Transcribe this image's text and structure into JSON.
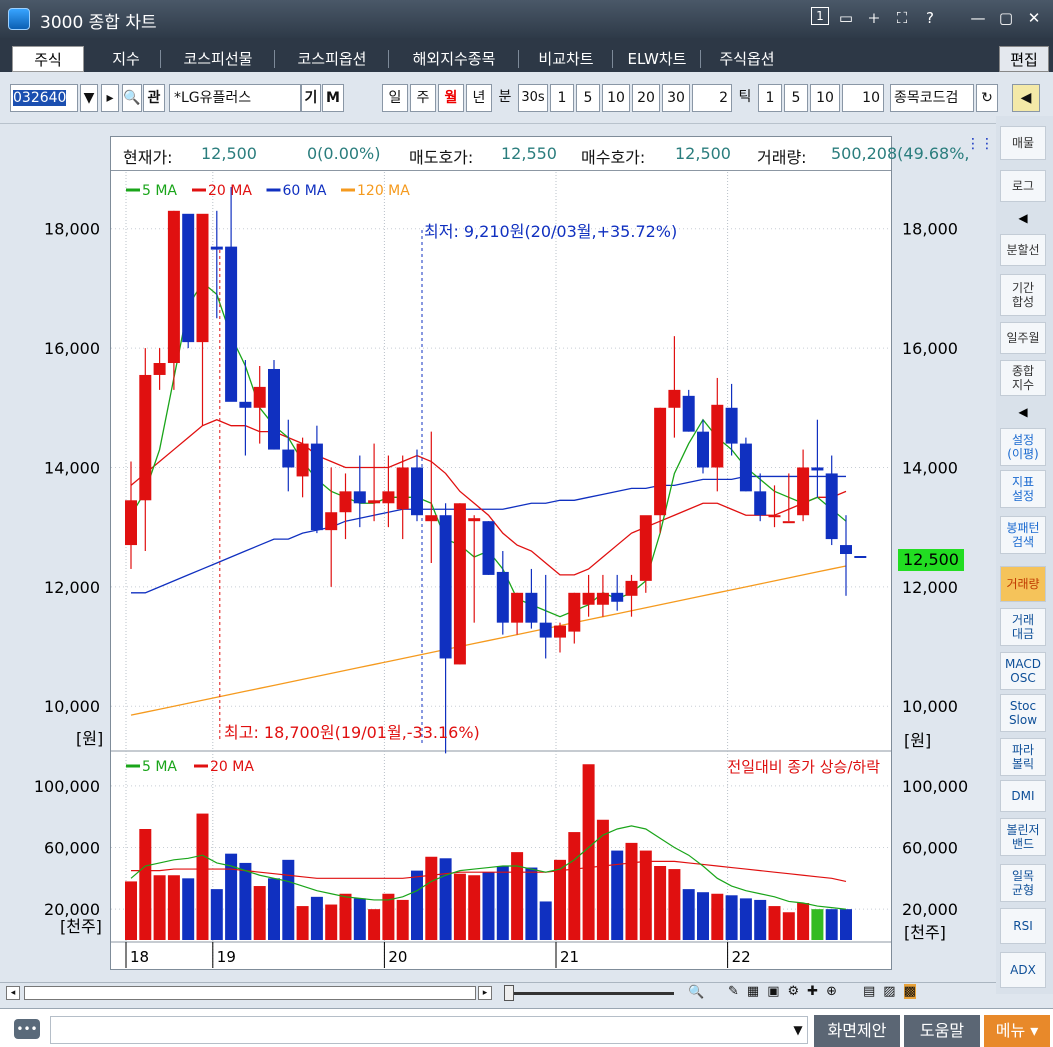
{
  "window": {
    "title": "3000 종합 차트"
  },
  "title_icons": [
    "1",
    "▭",
    "🞣",
    "⛶",
    "?",
    "—",
    "▢",
    "✕"
  ],
  "tabs": [
    "주식",
    "지수",
    "코스피선물",
    "코스피옵션",
    "해외지수종목",
    "비교차트",
    "ELW차트",
    "주식옵션"
  ],
  "edit_label": "편집",
  "toolbar": {
    "code": "032640",
    "name": "*LG유플러스",
    "gi": "기",
    "m": "M",
    "periods": [
      "일",
      "주",
      "월",
      "년",
      "분",
      "30s",
      "1",
      "5",
      "10",
      "20",
      "30"
    ],
    "active_period": "월",
    "tick_count": "2",
    "tick_label": "틱",
    "tick_opts": [
      "1",
      "5",
      "10"
    ],
    "tick_count2": "10",
    "search_placeholder": "종목코드검"
  },
  "info": {
    "current_label": "현재가:",
    "current": "12,500",
    "change": "0(0.00%)",
    "ask_label": "매도호가:",
    "ask": "12,550",
    "bid_label": "매수호가:",
    "bid": "12,500",
    "vol_label": "거래량:",
    "vol": "500,208(49.68%,"
  },
  "legend_price": [
    {
      "label": "5 MA",
      "color": "#1aa51a"
    },
    {
      "label": "20 MA",
      "color": "#e01010"
    },
    {
      "label": "60 MA",
      "color": "#1030c0"
    },
    {
      "label": "120 MA",
      "color": "#f59a1e"
    }
  ],
  "legend_volume": [
    {
      "label": "5 MA",
      "color": "#1aa51a"
    },
    {
      "label": "20 MA",
      "color": "#e01010"
    }
  ],
  "volume_caption": "전일대비 종가 상승/하락",
  "annotations": {
    "low": "최저: 9,210원(20/03월,+35.72%)",
    "high": "최고: 18,700원(19/01월,-33.16%)"
  },
  "price_axis": [
    "18,000",
    "16,000",
    "14,000",
    "12,000",
    "10,000"
  ],
  "price_unit": "[원]",
  "volume_axis": [
    "100,000",
    "60,000",
    "20,000"
  ],
  "volume_unit": "[천주]",
  "current_price_tag": "12,500",
  "x_years": [
    "18",
    "19",
    "20",
    "21",
    "22"
  ],
  "sidebar": [
    "매물",
    "로그",
    "◀",
    "분할선",
    "기간\n합성",
    "일주월",
    "종합\n지수",
    "◀",
    "설정\n(이평)",
    "지표\n설정",
    "봉패턴\n검색",
    "거래량",
    "거래\n대금",
    "MACD\nOSC",
    "Stoc\nSlow",
    "파라\n볼릭",
    "DMI",
    "볼린저\n밴드",
    "일목\n균형",
    "RSI",
    "ADX"
  ],
  "status": {
    "btn1": "화면제안",
    "btn2": "도움말",
    "btn3": "메뉴 ▾"
  },
  "chart_data": {
    "type": "candlestick",
    "ylim": [
      9300,
      18900
    ],
    "vol_ylim": [
      0,
      120000
    ],
    "candles": [
      {
        "o": 12700,
        "h": 14100,
        "l": 12300,
        "c": 13450,
        "v": 38000
      },
      {
        "o": 13450,
        "h": 16000,
        "l": 12600,
        "c": 15550,
        "v": 72000
      },
      {
        "o": 15550,
        "h": 16000,
        "l": 15300,
        "c": 15750,
        "v": 42000
      },
      {
        "o": 15750,
        "h": 18300,
        "l": 15300,
        "c": 18300,
        "v": 42000
      },
      {
        "o": 18250,
        "h": 18200,
        "l": 16000,
        "c": 16100,
        "v": 40000
      },
      {
        "o": 16100,
        "h": 18200,
        "l": 14700,
        "c": 18250,
        "v": 82000
      },
      {
        "o": 17700,
        "h": 18300,
        "l": 16500,
        "c": 17650,
        "v": 33000
      },
      {
        "o": 17700,
        "h": 18700,
        "l": 15800,
        "c": 15100,
        "v": 56000
      },
      {
        "o": 15100,
        "h": 15800,
        "l": 14200,
        "c": 15000,
        "v": 50000
      },
      {
        "o": 15000,
        "h": 15700,
        "l": 14400,
        "c": 15350,
        "v": 35000
      },
      {
        "o": 15650,
        "h": 15800,
        "l": 14300,
        "c": 14300,
        "v": 40000
      },
      {
        "o": 14300,
        "h": 14800,
        "l": 13600,
        "c": 14000,
        "v": 52000
      },
      {
        "o": 13850,
        "h": 14500,
        "l": 13500,
        "c": 14400,
        "v": 22000
      },
      {
        "o": 14400,
        "h": 14700,
        "l": 12900,
        "c": 12950,
        "v": 28000
      },
      {
        "o": 12950,
        "h": 14000,
        "l": 12000,
        "c": 13250,
        "v": 23000
      },
      {
        "o": 13250,
        "h": 13900,
        "l": 12800,
        "c": 13600,
        "v": 30000
      },
      {
        "o": 13600,
        "h": 14200,
        "l": 13000,
        "c": 13400,
        "v": 27000
      },
      {
        "o": 13400,
        "h": 14400,
        "l": 13100,
        "c": 13450,
        "v": 20000
      },
      {
        "o": 13400,
        "h": 14200,
        "l": 13000,
        "c": 13600,
        "v": 30000
      },
      {
        "o": 13300,
        "h": 14200,
        "l": 12800,
        "c": 14000,
        "v": 26000
      },
      {
        "o": 14000,
        "h": 14300,
        "l": 13100,
        "c": 13200,
        "v": 45000
      },
      {
        "o": 13100,
        "h": 14600,
        "l": 12400,
        "c": 13200,
        "v": 54000
      },
      {
        "o": 13200,
        "h": 13400,
        "l": 9210,
        "c": 10800,
        "v": 53000
      },
      {
        "o": 10700,
        "h": 13400,
        "l": 10700,
        "c": 13400,
        "v": 43000
      },
      {
        "o": 13100,
        "h": 13200,
        "l": 11400,
        "c": 13150,
        "v": 42000
      },
      {
        "o": 13100,
        "h": 13100,
        "l": 12200,
        "c": 12200,
        "v": 44000
      },
      {
        "o": 12250,
        "h": 12600,
        "l": 11200,
        "c": 11400,
        "v": 48000
      },
      {
        "o": 11400,
        "h": 11900,
        "l": 11200,
        "c": 11900,
        "v": 57000
      },
      {
        "o": 11900,
        "h": 12300,
        "l": 11300,
        "c": 11400,
        "v": 47000
      },
      {
        "o": 11400,
        "h": 12200,
        "l": 10800,
        "c": 11150,
        "v": 25000
      },
      {
        "o": 11150,
        "h": 11400,
        "l": 10900,
        "c": 11350,
        "v": 52000
      },
      {
        "o": 11250,
        "h": 11900,
        "l": 11050,
        "c": 11900,
        "v": 70000
      },
      {
        "o": 11700,
        "h": 12200,
        "l": 11500,
        "c": 11900,
        "v": 114000
      },
      {
        "o": 11700,
        "h": 12200,
        "l": 11500,
        "c": 11900,
        "v": 78000
      },
      {
        "o": 11900,
        "h": 12200,
        "l": 11600,
        "c": 11750,
        "v": 58000
      },
      {
        "o": 11850,
        "h": 12200,
        "l": 11500,
        "c": 12100,
        "v": 63000
      },
      {
        "o": 12100,
        "h": 12900,
        "l": 11900,
        "c": 13200,
        "v": 58000
      },
      {
        "o": 13200,
        "h": 15000,
        "l": 12900,
        "c": 15000,
        "v": 48000
      },
      {
        "o": 15000,
        "h": 16200,
        "l": 14500,
        "c": 15300,
        "v": 46000
      },
      {
        "o": 15200,
        "h": 15300,
        "l": 14600,
        "c": 14600,
        "v": 33000
      },
      {
        "o": 14600,
        "h": 14800,
        "l": 13900,
        "c": 14000,
        "v": 31000
      },
      {
        "o": 14000,
        "h": 15500,
        "l": 13600,
        "c": 15050,
        "v": 30000
      },
      {
        "o": 15000,
        "h": 15400,
        "l": 14200,
        "c": 14400,
        "v": 29000
      },
      {
        "o": 14400,
        "h": 14500,
        "l": 13600,
        "c": 13600,
        "v": 27000
      },
      {
        "o": 13600,
        "h": 13900,
        "l": 13100,
        "c": 13200,
        "v": 26000
      },
      {
        "o": 13200,
        "h": 13700,
        "l": 13000,
        "c": 13200,
        "v": 22000
      },
      {
        "o": 13100,
        "h": 13900,
        "l": 13100,
        "c": 13100,
        "v": 18000
      },
      {
        "o": 13200,
        "h": 14300,
        "l": 13100,
        "c": 14000,
        "v": 24000
      },
      {
        "o": 14000,
        "h": 14800,
        "l": 13500,
        "c": 13950,
        "v": 20000
      },
      {
        "o": 13900,
        "h": 14200,
        "l": 12700,
        "c": 12800,
        "v": 20000
      },
      {
        "o": 12700,
        "h": 13200,
        "l": 11850,
        "c": 12550,
        "v": 20000
      },
      {
        "o": 12500,
        "h": 12500,
        "l": 12500,
        "c": 12500,
        "v": 0
      }
    ],
    "ma5": [
      13200,
      13600,
      14300,
      15500,
      16700,
      17100,
      16900,
      16200,
      15700,
      15000,
      14700,
      14500,
      14100,
      13800,
      13600,
      13500,
      13400,
      13400,
      13500,
      13500,
      13500,
      13400,
      12800,
      12700,
      12500,
      12600,
      12300,
      11800,
      11700,
      11600,
      11500,
      11600,
      11700,
      11900,
      11800,
      11900,
      12100,
      12900,
      13900,
      14400,
      14800,
      14500,
      14300,
      14000,
      13800,
      13600,
      13500,
      13400,
      13500,
      13300,
      13100
    ],
    "ma20": [
      13700,
      13900,
      14100,
      14300,
      14500,
      14700,
      14800,
      14700,
      14700,
      14600,
      14600,
      14500,
      14400,
      14200,
      14100,
      14000,
      14000,
      14000,
      14000,
      14100,
      14200,
      14100,
      13900,
      13600,
      13400,
      13200,
      12900,
      12700,
      12600,
      12400,
      12200,
      12200,
      12300,
      12500,
      12700,
      12900,
      13000,
      13100,
      13200,
      13300,
      13400,
      13400,
      13300,
      13200,
      13200,
      13200,
      13300,
      13400,
      13500,
      13500,
      13600
    ],
    "ma60": [
      11900,
      11900,
      12000,
      12100,
      12200,
      12300,
      12400,
      12500,
      12600,
      12700,
      12800,
      12800,
      12900,
      12950,
      13000,
      13100,
      13150,
      13200,
      13250,
      13300,
      13300,
      13300,
      13300,
      13300,
      13300,
      13300,
      13300,
      13350,
      13400,
      13400,
      13450,
      13450,
      13500,
      13550,
      13600,
      13650,
      13650,
      13700,
      13700,
      13750,
      13800,
      13800,
      13800,
      13850,
      13850,
      13850,
      13850,
      13850,
      13850,
      13850,
      13850
    ],
    "ma120": [
      9850,
      9900,
      9950,
      10000,
      10050,
      10100,
      10150,
      10200,
      10250,
      10300,
      10350,
      10400,
      10450,
      10500,
      10550,
      10600,
      10650,
      10700,
      10750,
      10800,
      10850,
      10900,
      10950,
      11000,
      11050,
      11100,
      11150,
      11200,
      11250,
      11300,
      11350,
      11400,
      11450,
      11500,
      11550,
      11600,
      11650,
      11700,
      11750,
      11800,
      11850,
      11900,
      11950,
      12000,
      12050,
      12100,
      12150,
      12200,
      12250,
      12300,
      12350
    ],
    "vma5": [
      40000,
      48000,
      50000,
      52000,
      53000,
      55000,
      50000,
      48000,
      45000,
      42000,
      40000,
      38000,
      35000,
      32000,
      30000,
      28000,
      27000,
      26000,
      26000,
      28000,
      32000,
      38000,
      42000,
      45000,
      46000,
      47000,
      48000,
      48000,
      46000,
      44000,
      46000,
      52000,
      60000,
      68000,
      72000,
      74000,
      72000,
      66000,
      60000,
      55000,
      48000,
      40000,
      35000,
      32000,
      30000,
      28000,
      25000,
      24000,
      22000,
      21000,
      20000
    ],
    "vma20": [
      45000,
      45000,
      45000,
      46000,
      46000,
      46000,
      46000,
      46000,
      45000,
      44000,
      43000,
      42000,
      41000,
      40000,
      40000,
      40000,
      40000,
      40000,
      40000,
      40000,
      41000,
      42000,
      43000,
      44000,
      44000,
      44000,
      44000,
      44000,
      44000,
      44000,
      45000,
      46000,
      47000,
      48000,
      49000,
      50000,
      51000,
      51000,
      51000,
      50000,
      49000,
      48000,
      47000,
      46000,
      45000,
      44000,
      43000,
      42000,
      41000,
      40000,
      38000
    ]
  }
}
